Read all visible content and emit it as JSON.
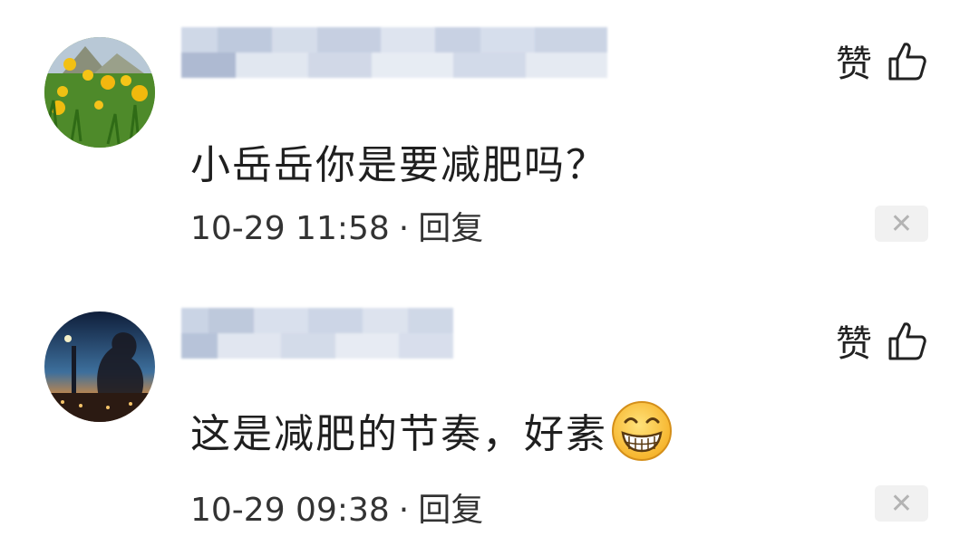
{
  "comments": [
    {
      "text": "小岳岳你是要减肥吗？",
      "timestamp": "10-29 11:58",
      "separator": "·",
      "reply": "回复",
      "like": "赞",
      "close": "✕"
    },
    {
      "text": "这是减肥的节奏，好素",
      "timestamp": "10-29 09:38",
      "separator": "·",
      "reply": "回复",
      "like": "赞",
      "close": "✕",
      "emoji": "grinning-emoji"
    }
  ]
}
